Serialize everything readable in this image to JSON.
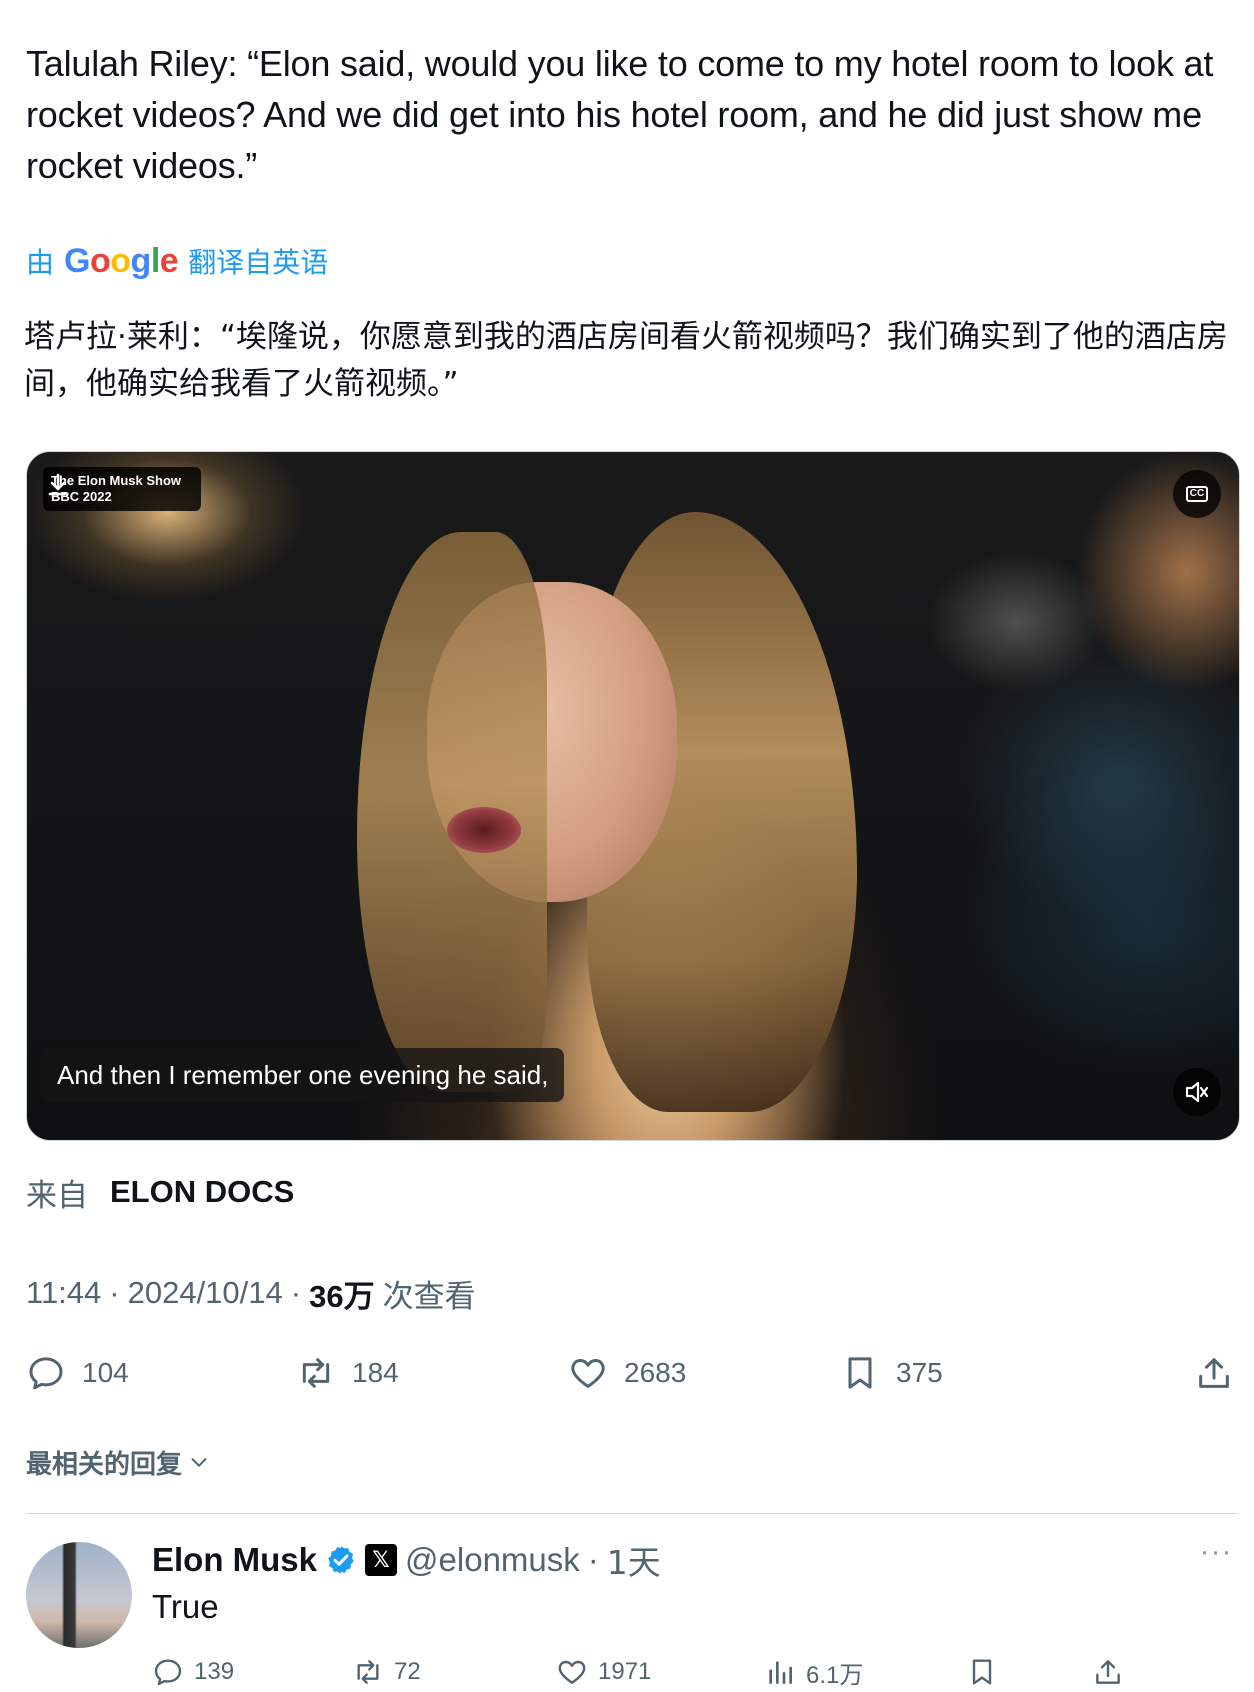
{
  "tweet": {
    "text": "Talulah Riley: “Elon said, would you like to come to my hotel room to look at rocket videos? And we did get into his hotel room, and he did just show me rocket videos.”",
    "translate_prefix": "由",
    "translate_brand": "Google",
    "translate_suffix": "翻译自英语",
    "translated_text": "塔卢拉·莱利：“埃隆说，你愿意到我的酒店房间看火箭视频吗？我们确实到了他的酒店房间，他确实给我看了火箭视频。”"
  },
  "video": {
    "badge_line1": "The Elon Musk Show",
    "badge_line2": "BBC 2022",
    "caption": "And then I remember one evening he said,",
    "icons": {
      "download": "download-icon",
      "cc": "cc-icon",
      "mute": "mute-icon"
    }
  },
  "source": {
    "label": "来自",
    "name": "ELON DOCS"
  },
  "meta": {
    "time": "11:44",
    "date": "2024/10/14",
    "views": "36万",
    "views_label": "次查看"
  },
  "actions": {
    "replies": "104",
    "retweets": "184",
    "likes": "2683",
    "bookmarks": "375",
    "icons": [
      "reply-icon",
      "retweet-icon",
      "like-icon",
      "bookmark-icon",
      "share-icon"
    ]
  },
  "replies_section": {
    "sort_label": "最相关的回复"
  },
  "reply": {
    "name": "Elon Musk",
    "handle": "@elonmusk",
    "time": "1天",
    "text": "True",
    "replies": "139",
    "retweets": "72",
    "likes": "1971",
    "views": "6.1万"
  },
  "colors": {
    "accent": "#1d9bf0",
    "secondary_text": "#536471",
    "primary_text": "#0f1419",
    "divider": "#cfd9de"
  }
}
